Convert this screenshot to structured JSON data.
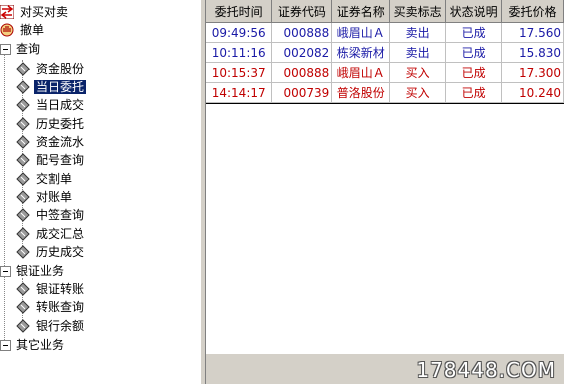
{
  "tree": {
    "nodes": [
      {
        "label": "对买对卖",
        "icon": "buy-sell-icon"
      },
      {
        "label": "撤单",
        "icon": "cancel-hand-icon"
      },
      {
        "label": "查询",
        "icon": "expander"
      },
      {
        "label": "资金股份",
        "icon": "diamond-icon"
      },
      {
        "label": "当日委托",
        "icon": "diamond-icon",
        "selected": true
      },
      {
        "label": "当日成交",
        "icon": "diamond-icon"
      },
      {
        "label": "历史委托",
        "icon": "diamond-icon"
      },
      {
        "label": "资金流水",
        "icon": "diamond-icon"
      },
      {
        "label": "配号查询",
        "icon": "diamond-icon"
      },
      {
        "label": "交割单",
        "icon": "diamond-icon"
      },
      {
        "label": "对账单",
        "icon": "diamond-icon"
      },
      {
        "label": "中签查询",
        "icon": "diamond-icon"
      },
      {
        "label": "成交汇总",
        "icon": "diamond-icon"
      },
      {
        "label": "历史成交",
        "icon": "diamond-icon"
      },
      {
        "label": "银证业务",
        "icon": "expander"
      },
      {
        "label": "银证转账",
        "icon": "diamond-icon"
      },
      {
        "label": "转账查询",
        "icon": "diamond-icon"
      },
      {
        "label": "银行余额",
        "icon": "diamond-icon"
      },
      {
        "label": "其它业务",
        "icon": "expander"
      }
    ]
  },
  "grid": {
    "columns": [
      "委托时间",
      "证券代码",
      "证券名称",
      "买卖标志",
      "状态说明",
      "委托价格"
    ],
    "rows": [
      {
        "time": "09:49:56",
        "code": "000888",
        "name": "峨眉山Ａ",
        "side": "卖出",
        "status": "已成",
        "price": "17.560",
        "side_color": "#1a1aa6"
      },
      {
        "time": "10:11:16",
        "code": "002082",
        "name": "栋梁新材",
        "side": "卖出",
        "status": "已成",
        "price": "15.830",
        "side_color": "#1a1aa6"
      },
      {
        "time": "10:15:37",
        "code": "000888",
        "name": "峨眉山Ａ",
        "side": "买入",
        "status": "已成",
        "price": "17.300",
        "side_color": "#c00000"
      },
      {
        "time": "14:14:17",
        "code": "000739",
        "name": "普洛股份",
        "side": "买入",
        "status": "已成",
        "price": "10.240",
        "side_color": "#c00000"
      }
    ]
  },
  "watermark": "178448.COM",
  "colors": {
    "sell": "#1a1aa6",
    "buy": "#c00000",
    "selection": "#0a246a"
  }
}
